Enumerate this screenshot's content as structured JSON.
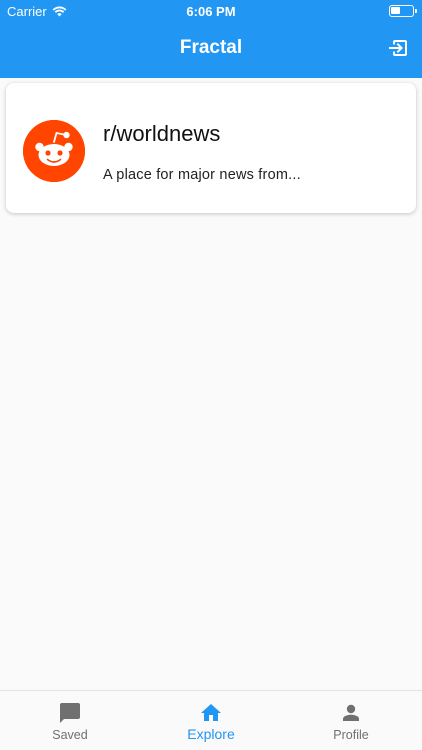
{
  "status_bar": {
    "carrier": "Carrier",
    "time": "6:06 PM",
    "wifi_icon": "wifi-icon",
    "battery_icon": "battery-icon"
  },
  "header": {
    "title": "Fractal",
    "logout_icon": "logout-icon",
    "background_color": "#2196f3"
  },
  "subreddits": [
    {
      "name": "r/worldnews",
      "description": "A place for major news from...",
      "avatar_icon": "reddit-snoo-icon",
      "avatar_color": "#ff4500"
    }
  ],
  "tab_bar": {
    "tabs": [
      {
        "label": "Saved",
        "icon": "chat-bubble-icon",
        "active": false
      },
      {
        "label": "Explore",
        "icon": "home-icon",
        "active": true
      },
      {
        "label": "Profile",
        "icon": "person-icon",
        "active": false
      }
    ],
    "active_color": "#2196f3",
    "inactive_color": "#707070"
  }
}
